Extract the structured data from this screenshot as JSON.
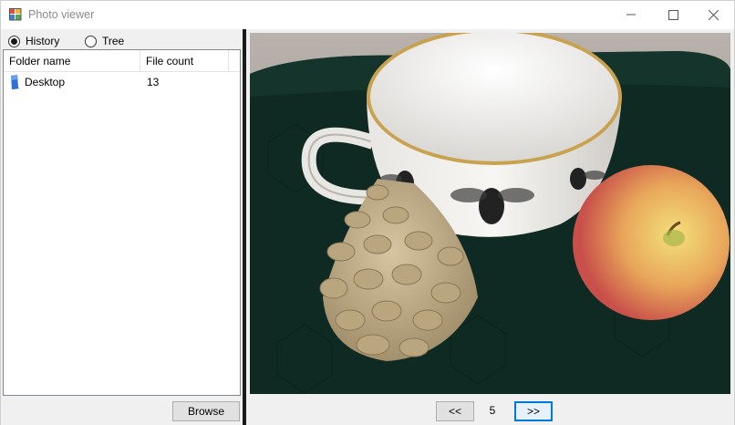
{
  "window": {
    "title": "Photo viewer",
    "app_icon": "app-grid-icon",
    "controls": {
      "minimize": "minimize-icon",
      "maximize": "maximize-icon",
      "close": "close-icon"
    }
  },
  "view_mode": {
    "options": [
      {
        "label": "History",
        "checked": true
      },
      {
        "label": "Tree",
        "checked": false
      }
    ]
  },
  "folder_list": {
    "columns": [
      "Folder name",
      "File count"
    ],
    "rows": [
      {
        "name": "Desktop",
        "count": "13",
        "icon": "folder-icon"
      }
    ]
  },
  "buttons": {
    "browse": "Browse"
  },
  "navigation": {
    "prev_label": "<<",
    "next_label": ">>",
    "current_page": "5"
  },
  "photo": {
    "description_icon": "photo-image"
  },
  "colors": {
    "accent": "#0078d7",
    "splitter": "#1a1a1a"
  }
}
